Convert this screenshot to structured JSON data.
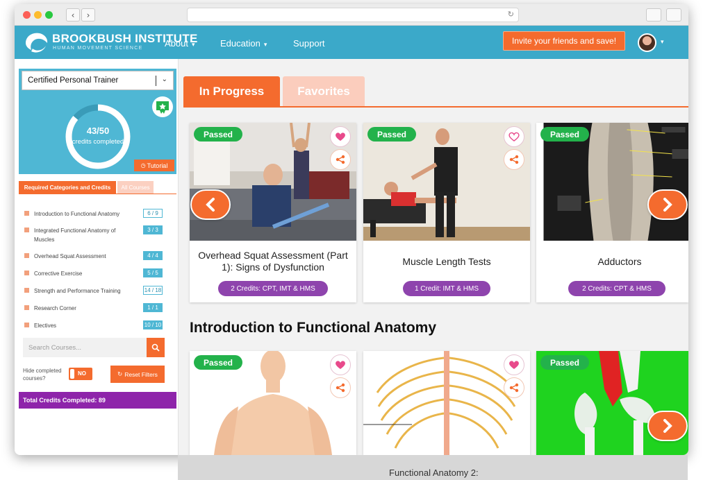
{
  "header": {
    "logo_title": "BROOKBUSH INSTITUTE",
    "logo_subtitle": "HUMAN MOVEMENT SCIENCE",
    "nav": [
      {
        "label": "About"
      },
      {
        "label": "Education"
      },
      {
        "label": "Support"
      }
    ],
    "invite_label": "Invite your friends and save!"
  },
  "sidebar": {
    "program_select": "Certified Personal Trainer",
    "credits_value": "43/50",
    "credits_label": "credits completed",
    "credits_progress": 0.86,
    "tutorial_label": "Tutorial",
    "tabs": {
      "required": "Required Categories and Credits",
      "all": "All Courses"
    },
    "categories": [
      {
        "label": "Introduction to Functional Anatomy",
        "count": "6 / 9",
        "full": false
      },
      {
        "label": "Integrated Functional Anatomy of Muscles",
        "count": "3 / 3",
        "full": true
      },
      {
        "label": "Overhead Squat Assessment",
        "count": "4 / 4",
        "full": true
      },
      {
        "label": "Corrective Exercise",
        "count": "5 / 5",
        "full": true
      },
      {
        "label": "Strength and Performance Training",
        "count": "14 / 18",
        "full": false
      },
      {
        "label": "Research Corner",
        "count": "1 / 1",
        "full": true
      },
      {
        "label": "Electives",
        "count": "10 / 10",
        "full": true
      }
    ],
    "search_placeholder": "Search Courses...",
    "hide_label": "Hide completed courses?",
    "hide_value": "NO",
    "reset_label": "Reset Filters",
    "total_label": "Total Credits Completed:  89"
  },
  "main": {
    "tabs": {
      "in_progress": "In Progress",
      "favorites": "Favorites"
    },
    "passed_label": "Passed",
    "cards_row1": [
      {
        "title": "Overhead Squat Assessment (Part 1): Signs of Dysfunction",
        "credit": "2 Credits:  CPT, IMT & HMS"
      },
      {
        "title": "Muscle Length Tests",
        "credit": "1 Credit:  IMT & HMS"
      },
      {
        "title": "Adductors",
        "credit": "2 Credits:  CPT & HMS"
      }
    ],
    "section_title": "Introduction to Functional Anatomy",
    "cards_row2_bottom_title": "Functional Anatomy 2:"
  },
  "colors": {
    "brand_blue": "#3ba9c9",
    "accent_orange": "#f46b2e",
    "purple": "#8e44ad",
    "passed_green": "#23b24b"
  }
}
